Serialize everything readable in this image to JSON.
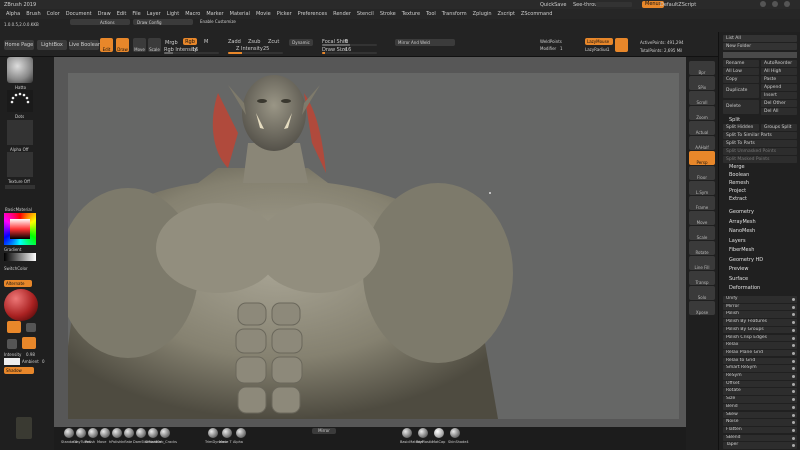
{
  "app": {
    "title": "ZBrush 2019",
    "quicksave": "QuickSave",
    "see_through_label": "See-through",
    "see_through_value": "0",
    "menus_label": "Menus",
    "script_label": "DefaultZScript"
  },
  "menu": [
    "Alpha",
    "Brush",
    "Color",
    "Document",
    "Draw",
    "Edit",
    "File",
    "Layer",
    "Light",
    "Macro",
    "Marker",
    "Material",
    "Movie",
    "Picker",
    "Preferences",
    "Render",
    "Stencil",
    "Stroke",
    "Texture",
    "Tool",
    "Transform",
    "Zplugin",
    "Zscript",
    "ZScommand"
  ],
  "toolbar": {
    "path": "1.0.0.5,2.0.0.KKB",
    "project_dropdown": "Actions",
    "draw_config": "Draw Config",
    "enable_customize": "Enable Customize",
    "home_page": "Home Page",
    "lightbox": "LightBox",
    "live_boolean": "Live Boolean",
    "edit": "Edit",
    "draw": "Draw",
    "move": "Move",
    "scale": "Scale",
    "rotate": "Rotate",
    "mrgb": "Mrgb",
    "rgb": "Rgb",
    "m": "M",
    "rgb_intensity_label": "Rgb Intensity",
    "rgb_intensity_value": "16",
    "zadd": "Zadd",
    "zsub": "Zsub",
    "zcut": "Zcut",
    "z_intensity_label": "Z Intensity",
    "z_intensity_value": "25",
    "focal_shift_label": "Focal Shift",
    "focal_shift_value": "0",
    "draw_size_label": "Draw Size",
    "draw_size_value": "16",
    "dynamic": "Dynamic",
    "mirror_and_weld": "Mirror And Weld",
    "weld_points": "WeldPoints",
    "modifier_label": "Modifier",
    "modifier_value": "1",
    "lazy_mouse": "LazyMouse",
    "lazy_radius_label": "LazyRadius",
    "lazy_radius_value": "1",
    "active_points": "ActivePoints: 491,294",
    "total_points": "TotalPoints: 2,695 Mil"
  },
  "left_shelf": {
    "brush_name": "Hatto",
    "stroke_name": "Dots",
    "alpha_name": "Alpha Off",
    "texture_name": "Texture Off",
    "material_name": "BasicMaterial",
    "gradient": "Gradient",
    "switch_color": "SwitchColor",
    "alternate": "Alternate",
    "intensity_label": "Intensity",
    "intensity_value": "0.98",
    "ambient_label": "Ambient",
    "ambient_value": "0",
    "shadow": "Shadow"
  },
  "bottom_shelf": {
    "mirror": "Mirror",
    "brushes": [
      "Standard",
      "ClayTubes",
      "Polish",
      "Move",
      "hPolish",
      "Inflate",
      "DamStandard",
      "SMoother",
      "Orb_Cracks",
      "TrimDynamic",
      "Move T",
      "Alpha"
    ],
    "materials": [
      "BasicMaterial",
      "ToyPlastic",
      "MatCap",
      "SkinShade4"
    ]
  },
  "right_shelf": [
    "Bpr",
    "SPix",
    "Scroll",
    "Zoom",
    "Actual",
    "AAHalf",
    "Persp",
    "Floor",
    "L.Sym",
    "Frame",
    "Move",
    "Scale",
    "Rotate",
    "Line Fill",
    "Transp",
    "Solo",
    "Xpose"
  ],
  "palette": {
    "list_all": "List All",
    "new_folder": "New Folder",
    "rename": "Rename",
    "auto_reorder": "AutoReorder",
    "all_low": "All Low",
    "all_high": "All High",
    "copy": "Copy",
    "paste": "Paste",
    "duplicate": "Duplicate",
    "append": "Append",
    "insert": "Insert",
    "delete": "Delete",
    "del_other": "Del Other",
    "del_all": "Del All",
    "split_label": "Split",
    "split_hidden": "Split Hidden",
    "groups_split": "Groups Split",
    "split_similar": "Split To Similar Parts",
    "split_parts": "Split To Parts",
    "split_unmasked": "Split Unmasked Points",
    "split_masked": "Split Masked Points",
    "merge": "Merge",
    "boolean": "Boolean",
    "remesh": "Remesh",
    "project": "Project",
    "extract": "Extract",
    "sections": [
      "Geometry",
      "ArrayMesh",
      "NanoMesh",
      "Layers",
      "FiberMesh",
      "Geometry HD",
      "Preview",
      "Surface",
      "Deformation"
    ],
    "deformation_items": [
      "Unify",
      "Mirror",
      "Polish",
      "Polish By Features",
      "Polish By Groups",
      "Polish Crisp Edges",
      "Relax",
      "Relax Plane Grid",
      "Relax to Grid",
      "Smart ReSym",
      "ReSym",
      "Offset",
      "Rotate",
      "Size",
      "Bend",
      "Skew",
      "Noise",
      "Flatten",
      "SBend",
      "Taper"
    ]
  },
  "status": {
    "collapse_indicator": "<"
  }
}
